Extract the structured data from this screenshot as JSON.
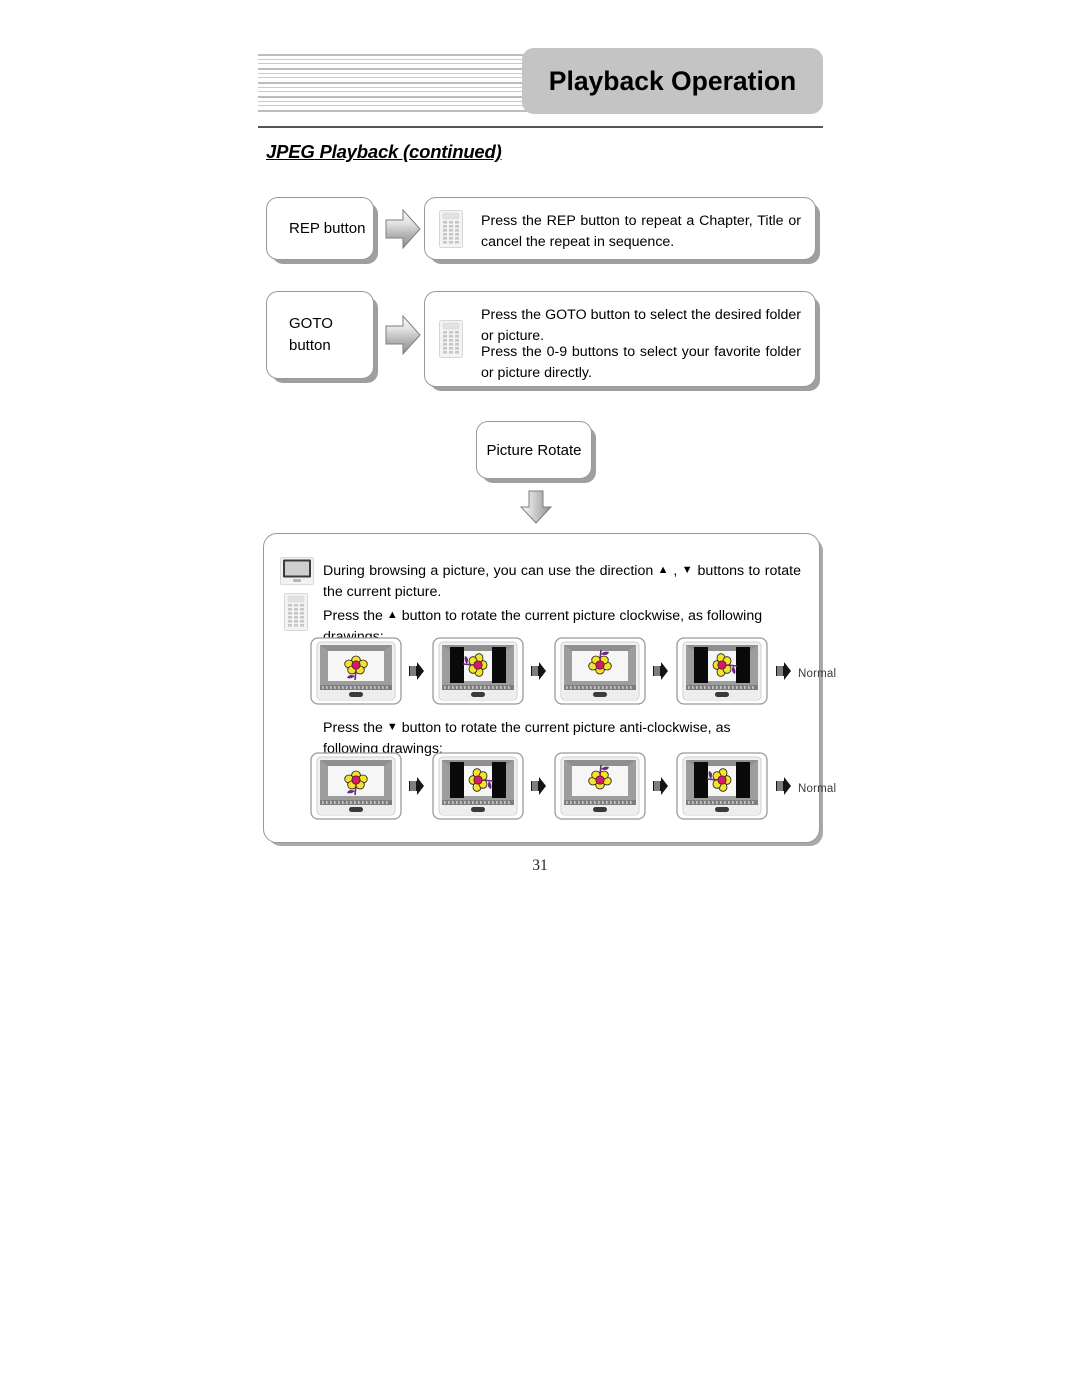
{
  "document": {
    "header_title": "Playback Operation",
    "section_title": "JPEG Playback (continued)",
    "page_number": "31"
  },
  "rows": [
    {
      "label": "REP button",
      "icon": "remote-icon",
      "arrow": "block-arrow-right",
      "paragraphs": [
        "Press the REP button to repeat a Chapter, Title or cancel the repeat in sequence."
      ]
    },
    {
      "label": "GOTO\nbutton",
      "label_line1": "GOTO",
      "label_line2": "button",
      "icon": "remote-icon",
      "arrow": "block-arrow-right",
      "paragraphs": [
        "Press the GOTO button to select the desired folder or picture.",
        "Press the 0-9 buttons to select your favorite folder or picture directly."
      ]
    }
  ],
  "rotate_section": {
    "label": "Picture Rotate",
    "down_arrow": "down-arrow-icon",
    "tv_icon": "tv-icon",
    "remote_icon": "remote-icon",
    "intro_text_a": "During browsing a picture, you can use the direction ",
    "intro_caret_up": "▲",
    "intro_text_b": " , ",
    "intro_caret_down": "▼",
    "intro_text_c": " buttons to rotate the current picture.",
    "clockwise_text_a": "Press the ",
    "clockwise_caret": "▲",
    "clockwise_text_b": " button to rotate the current picture clockwise, as following drawings:",
    "anticlockwise_text_a": "Press the ",
    "anticlockwise_caret": "▼",
    "anticlockwise_text_b": " button to rotate the current picture anti-clockwise, as following drawings:",
    "normal_label": "Normal",
    "clockwise_steps": [
      {
        "name": "tv-frame-0deg",
        "rotation": 0,
        "letterbox": false
      },
      {
        "name": "tv-frame-90deg",
        "rotation": 90,
        "letterbox": true
      },
      {
        "name": "tv-frame-180deg",
        "rotation": 180,
        "letterbox": false
      },
      {
        "name": "tv-frame-270deg",
        "rotation": 270,
        "letterbox": true
      }
    ],
    "anticlockwise_steps": [
      {
        "name": "tv-frame-0deg",
        "rotation": 0,
        "letterbox": false
      },
      {
        "name": "tv-frame-270deg",
        "rotation": -90,
        "letterbox": true
      },
      {
        "name": "tv-frame-180deg",
        "rotation": 180,
        "letterbox": false
      },
      {
        "name": "tv-frame-90deg",
        "rotation": -270,
        "letterbox": true
      }
    ]
  },
  "colors": {
    "header_box": "#c4c4c4",
    "rule": "#555555",
    "box_border": "#9a9a9a",
    "box_shadow": "#a0a0a0",
    "flower_petal": "#f5e32a",
    "flower_center": "#d8176f",
    "stem": "#6b2a7a"
  }
}
